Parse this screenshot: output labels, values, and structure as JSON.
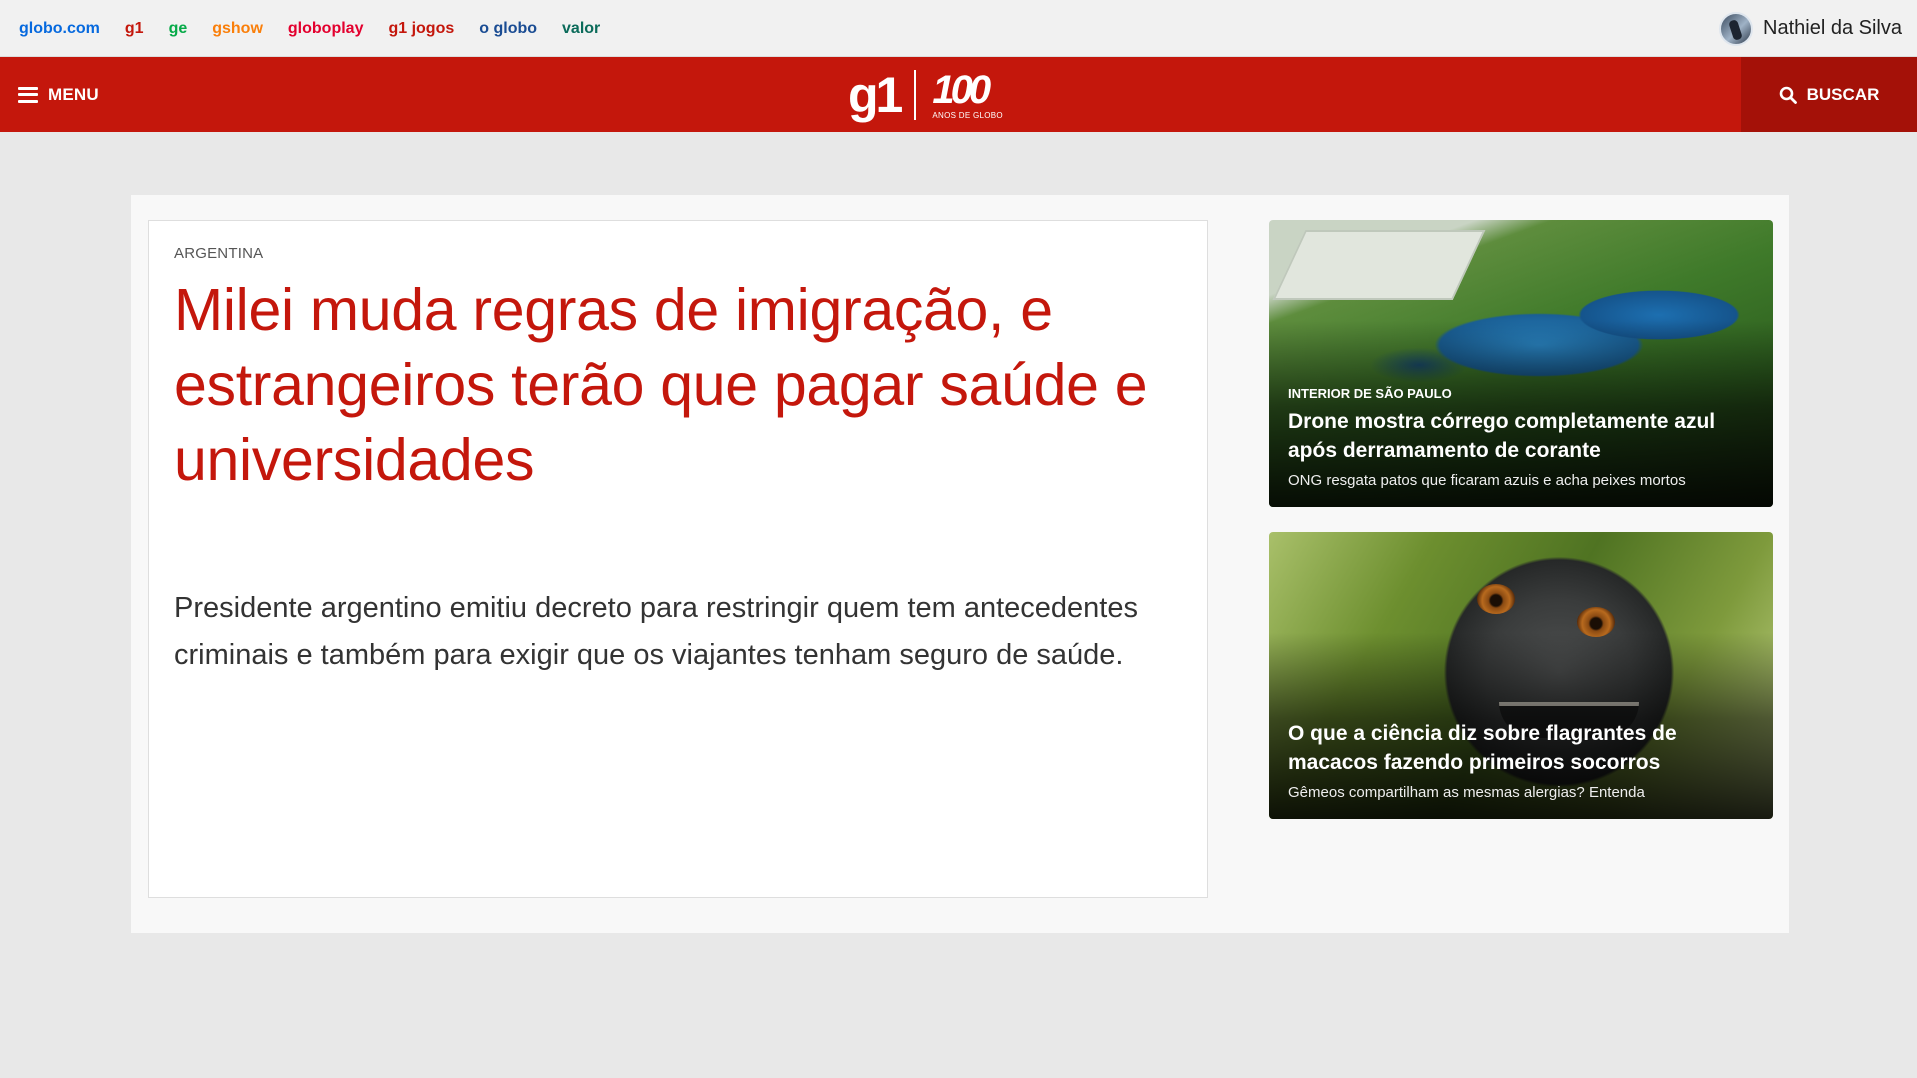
{
  "globo_bar": {
    "links": [
      {
        "label": "globo.com",
        "color": "#0669de"
      },
      {
        "label": "g1",
        "color": "#c4170c"
      },
      {
        "label": "ge",
        "color": "#06aa48"
      },
      {
        "label": "gshow",
        "color": "#fa7f0a"
      },
      {
        "label": "globoplay",
        "color": "#e3002e"
      },
      {
        "label": "g1 jogos",
        "color": "#c4170c"
      },
      {
        "label": "o globo",
        "color": "#1a4c93"
      },
      {
        "label": "valor",
        "color": "#0b6b5a"
      }
    ],
    "user_name": "Nathiel da Silva"
  },
  "header": {
    "menu_label": "MENU",
    "logo_text": "g1",
    "logo_badge": "100",
    "logo_badge_sub": "ANOS DE GLOBO",
    "search_label": "BUSCAR",
    "brand_color": "#c4170c"
  },
  "lead": {
    "kicker": "ARGENTINA",
    "title": "Milei muda regras de imigração, e estrangeiros terão que pagar saúde e universidades",
    "summary": "Presidente argentino emitiu decreto para restringir quem tem antecedentes criminais e também para exigir que os viajantes tenham seguro de saúde."
  },
  "side_cards": [
    {
      "kicker": "INTERIOR DE SÃO PAULO",
      "title": "Drone mostra córrego completamente azul após derramamento de corante",
      "subtitle": "ONG resgata patos que ficaram azuis e acha peixes mortos"
    },
    {
      "kicker": "",
      "title": "O que a ciência diz sobre flagrantes de macacos fazendo primeiros socorros",
      "subtitle": "Gêmeos compartilham as mesmas alergias? Entenda"
    }
  ]
}
